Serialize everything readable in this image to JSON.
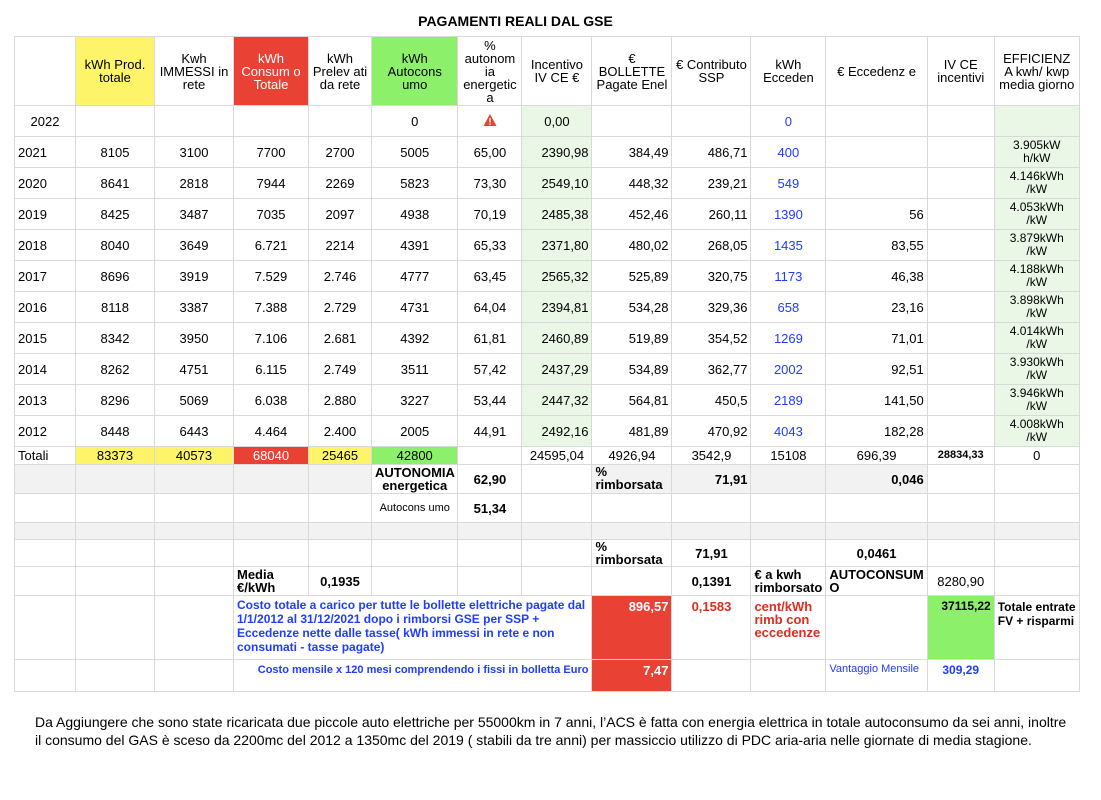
{
  "title": "PAGAMENTI REALI DAL GSE",
  "headers": {
    "c1": "kWh Prod. totale",
    "c2": "Kwh IMMESSI in rete",
    "c3": "kWh Consum o Totale",
    "c4": "kWh Prelev ati da rete",
    "c5": "kWh Autocons umo",
    "c6": "% autonom ia energetic a",
    "c7": "Incentivo IV CE €",
    "c8": "€ BOLLETTE Pagate Enel",
    "c9": "€ Contributo SSP",
    "c10": "kWh Ecceden",
    "c11": "€ Eccedenz e",
    "c12": "IV CE incentivi",
    "c13": "EFFICIENZ A kwh/ kwp media giorno"
  },
  "row2022": {
    "year": "2022",
    "autocons": "0",
    "warning_icon": "warning-triangle-icon",
    "incentivo": "0,00",
    "ecceden": "0"
  },
  "years": [
    {
      "year": "2021",
      "prod": "8105",
      "imm": "3100",
      "cons": "7700",
      "prel": "2700",
      "auto": "5005",
      "pct": "65,00",
      "inc": "2390,98",
      "boll": "384,49",
      "ssp": "486,71",
      "ecc": "400",
      "eccE": "",
      "eff": "3.905kW h/kW"
    },
    {
      "year": "2020",
      "prod": "8641",
      "imm": "2818",
      "cons": "7944",
      "prel": "2269",
      "auto": "5823",
      "pct": "73,30",
      "inc": "2549,10",
      "boll": "448,32",
      "ssp": "239,21",
      "ecc": "549",
      "eccE": "",
      "eff": "4.146kWh /kW"
    },
    {
      "year": "2019",
      "prod": "8425",
      "imm": "3487",
      "cons": "7035",
      "prel": "2097",
      "auto": "4938",
      "pct": "70,19",
      "inc": "2485,38",
      "boll": "452,46",
      "ssp": "260,11",
      "ecc": "1390",
      "eccE": "56",
      "eff": "4.053kWh /kW"
    },
    {
      "year": "2018",
      "prod": "8040",
      "imm": "3649",
      "cons": "6.721",
      "prel": "2214",
      "auto": "4391",
      "pct": "65,33",
      "inc": "2371,80",
      "boll": "480,02",
      "ssp": "268,05",
      "ecc": "1435",
      "eccE": "83,55",
      "eff": "3.879kWh /kW"
    },
    {
      "year": "2017",
      "prod": "8696",
      "imm": "3919",
      "cons": "7.529",
      "prel": "2.746",
      "auto": "4777",
      "pct": "63,45",
      "inc": "2565,32",
      "boll": "525,89",
      "ssp": "320,75",
      "ecc": "1173",
      "eccE": "46,38",
      "eff": "4.188kWh /kW"
    },
    {
      "year": "2016",
      "prod": "8118",
      "imm": "3387",
      "cons": "7.388",
      "prel": "2.729",
      "auto": "4731",
      "pct": "64,04",
      "inc": "2394,81",
      "boll": "534,28",
      "ssp": "329,36",
      "ecc": "658",
      "eccE": "23,16",
      "eff": "3.898kWh /kW"
    },
    {
      "year": "2015",
      "prod": "8342",
      "imm": "3950",
      "cons": "7.106",
      "prel": "2.681",
      "auto": "4392",
      "pct": "61,81",
      "inc": "2460,89",
      "boll": "519,89",
      "ssp": "354,52",
      "ecc": "1269",
      "eccE": "71,01",
      "eff": "4.014kWh /kW"
    },
    {
      "year": "2014",
      "prod": "8262",
      "imm": "4751",
      "cons": "6.115",
      "prel": "2.749",
      "auto": "3511",
      "pct": "57,42",
      "inc": "2437,29",
      "boll": "534,89",
      "ssp": "362,77",
      "ecc": "2002",
      "eccE": "92,51",
      "eff": "3.930kWh /kW"
    },
    {
      "year": "2013",
      "prod": "8296",
      "imm": "5069",
      "cons": "6.038",
      "prel": "2.880",
      "auto": "3227",
      "pct": "53,44",
      "inc": "2447,32",
      "boll": "564,81",
      "ssp": "450,5",
      "ecc": "2189",
      "eccE": "141,50",
      "eff": "3.946kWh /kW"
    },
    {
      "year": "2012",
      "prod": "8448",
      "imm": "6443",
      "cons": "4.464",
      "prel": "2.400",
      "auto": "2005",
      "pct": "44,91",
      "inc": "2492,16",
      "boll": "481,89",
      "ssp": "470,92",
      "ecc": "4043",
      "eccE": "182,28",
      "eff": "4.008kWh /kW"
    }
  ],
  "totals": {
    "label": "Totali",
    "prod": "83373",
    "imm": "40573",
    "cons": "68040",
    "prel": "25465",
    "auto": "42800",
    "inc": "24595,04",
    "boll": "4926,94",
    "ssp": "3542,9",
    "ecc": "15108",
    "eccE": "696,39",
    "ivce": "28834,33",
    "eff": "0"
  },
  "summary": {
    "autonomia_label": "AUTONOMIA energetica",
    "autonomia_value": "62,90",
    "rimb_label": "% rimborsata",
    "rimb_value": "71,91",
    "ecc_value": "0,046",
    "autocons_label": "Autocons umo",
    "autocons_value": "51,34",
    "rimb2_label": "% rimborsata",
    "rimb2_value": "71,91",
    "ecc2_value": "0,0461",
    "media_label": "Media €/kWh",
    "media_value": "0,1935",
    "ssp_kwh": "0,1391",
    "kwh_rimb_label": "€ a kwh rimborsato",
    "autoconsumo_label": "AUTOCONSUM O",
    "autoconsumo_value": "8280,90",
    "costo_totale_text": "Costo totale a carico per tutte le bollette elettriche pagate dal 1/1/2012 al 31/12/2021 dopo i rimborsi GSE per SSP + Eccedenze nette dalle tasse( kWh immessi in rete e non consumati - tasse pagate)",
    "costo_totale_value": "896,57",
    "cent_value": "0,1583",
    "cent_label": "cent/kWh rimb con eccedenze",
    "entrate_value": "37115,22",
    "entrate_label": "Totale entrate FV + risparmi",
    "costo_mensile_text": "Costo mensile x 120 mesi comprendendo i fissi in bolletta Euro",
    "costo_mensile_value": "7,47",
    "vantaggio_label": "Vantaggio Mensile",
    "vantaggio_value": "309,29"
  },
  "note": "Da Aggiungere che sono state ricaricata due piccole auto elettriche per 55000km in 7 anni, l’ACS è fatta con energia elettrica in totale autoconsumo da sei anni, inoltre il consumo del GAS è sceso da 2200mc del 2012 a 1350mc del 2019 ( stabili da tre anni) per massiccio utilizzo di PDC aria-aria nelle giornate di media stagione.",
  "colors": {
    "yellow": "#fef46a",
    "red": "#e94235",
    "green": "#8df06a",
    "light_green": "#eaf6e6",
    "blue_text": "#1f3cff"
  }
}
